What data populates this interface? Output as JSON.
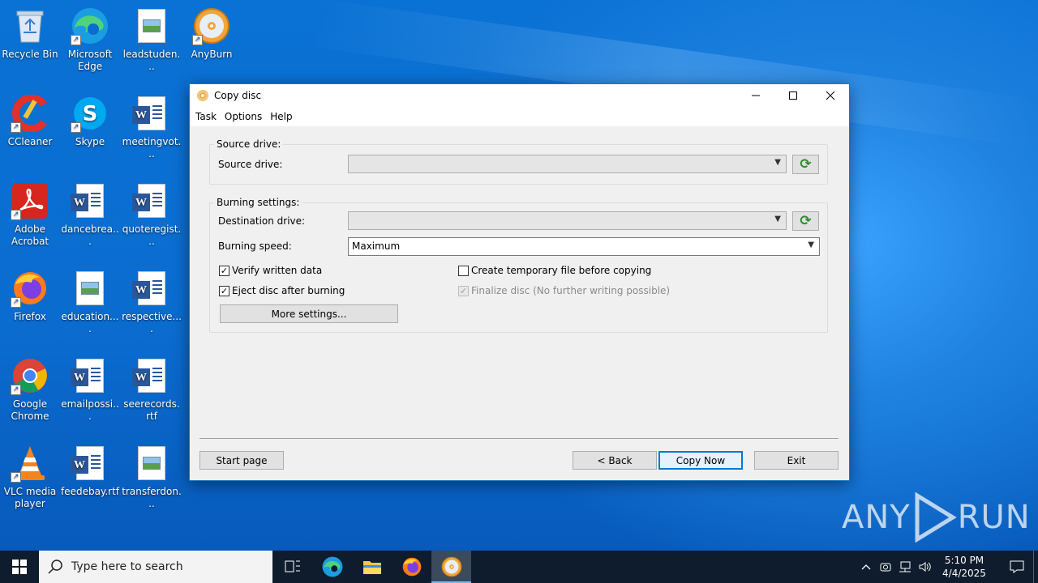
{
  "desktop": {
    "icons": [
      {
        "label": "Recycle Bin",
        "type": "recycle"
      },
      {
        "label": "Microsoft Edge",
        "type": "edge"
      },
      {
        "label": "leadstuden...",
        "type": "image-doc"
      },
      {
        "label": "AnyBurn",
        "type": "disc"
      },
      {
        "label": "CCleaner",
        "type": "ccleaner"
      },
      {
        "label": "Skype",
        "type": "skype"
      },
      {
        "label": "meetingvot...",
        "type": "word"
      },
      {
        "label": "Adobe Acrobat",
        "type": "acrobat"
      },
      {
        "label": "dancebrea...",
        "type": "word"
      },
      {
        "label": "quoteregist...",
        "type": "word"
      },
      {
        "label": "Firefox",
        "type": "firefox"
      },
      {
        "label": "education....",
        "type": "image-doc"
      },
      {
        "label": "respective....",
        "type": "word"
      },
      {
        "label": "Google Chrome",
        "type": "chrome"
      },
      {
        "label": "emailpossi...",
        "type": "word"
      },
      {
        "label": "seerecords.rtf",
        "type": "word"
      },
      {
        "label": "VLC media player",
        "type": "vlc"
      },
      {
        "label": "feedebay.rtf",
        "type": "word"
      },
      {
        "label": "transferdon...",
        "type": "image-doc"
      }
    ]
  },
  "window": {
    "title": "Copy disc",
    "menu": [
      "Task",
      "Options",
      "Help"
    ],
    "source_group": {
      "title": "Source drive:",
      "field_label": "Source drive:",
      "value": ""
    },
    "burning_group": {
      "title": "Burning settings:",
      "destination_label": "Destination drive:",
      "destination_value": "",
      "speed_label": "Burning speed:",
      "speed_value": "Maximum",
      "verify_label": "Verify written data",
      "verify_checked": true,
      "eject_label": "Eject disc after burning",
      "eject_checked": true,
      "temp_label": "Create temporary file before copying",
      "temp_checked": false,
      "finalize_label": "Finalize disc (No further writing possible)",
      "finalize_checked": true,
      "finalize_disabled": true,
      "more_settings_label": "More settings..."
    },
    "buttons": {
      "start_page": "Start page",
      "back": "< Back",
      "copy_now": "Copy Now",
      "exit": "Exit"
    }
  },
  "taskbar": {
    "search_placeholder": "Type here to search",
    "time": "5:10 PM",
    "date": "4/4/2025"
  },
  "watermark": {
    "text_left": "ANY",
    "text_right": "RUN"
  },
  "colors": {
    "accent": "#0078d7",
    "desktop": "#0b6cd0",
    "taskbar": "#0f1c2d",
    "refresh_green": "#2e8b2e"
  }
}
